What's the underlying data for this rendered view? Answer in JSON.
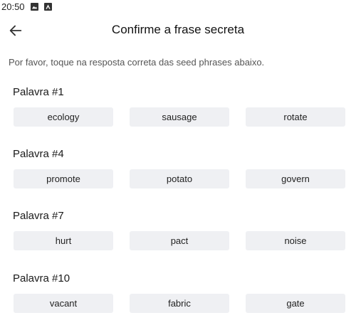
{
  "status_bar": {
    "time": "20:50",
    "icons": [
      "image-icon",
      "app-icon"
    ]
  },
  "header": {
    "title": "Confirme a frase secreta",
    "back_icon": "arrow-left-icon"
  },
  "instruction": "Por favor, toque na resposta correta das seed phrases abaixo.",
  "questions": [
    {
      "label": "Palavra #1",
      "options": [
        "ecology",
        "sausage",
        "rotate"
      ]
    },
    {
      "label": "Palavra #4",
      "options": [
        "promote",
        "potato",
        "govern"
      ]
    },
    {
      "label": "Palavra #7",
      "options": [
        "hurt",
        "pact",
        "noise"
      ]
    },
    {
      "label": "Palavra #10",
      "options": [
        "vacant",
        "fabric",
        "gate"
      ]
    }
  ]
}
